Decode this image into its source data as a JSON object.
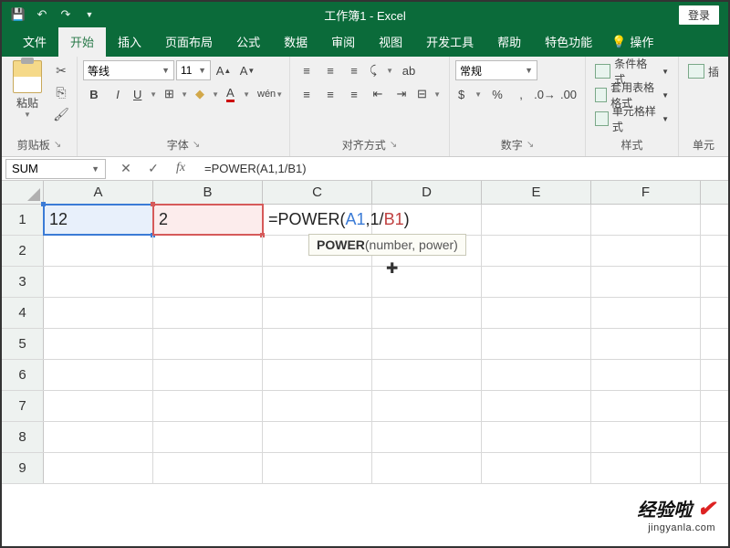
{
  "titlebar": {
    "title": "工作簿1 - Excel",
    "login": "登录"
  },
  "tabs": {
    "file": "文件",
    "home": "开始",
    "insert": "插入",
    "layout": "页面布局",
    "formulas": "公式",
    "data": "数据",
    "review": "审阅",
    "view": "视图",
    "developer": "开发工具",
    "help": "帮助",
    "special": "特色功能",
    "tell_me": "操作"
  },
  "ribbon": {
    "clipboard": {
      "label": "剪贴板",
      "paste": "粘贴"
    },
    "font": {
      "label": "字体",
      "name": "等线",
      "size": "11"
    },
    "align": {
      "label": "对齐方式"
    },
    "number": {
      "label": "数字",
      "format": "常规"
    },
    "styles": {
      "label": "样式",
      "conditional": "条件格式",
      "table": "套用表格格式",
      "cell": "单元格样式"
    },
    "cells": {
      "label": "单元",
      "insert": "插"
    }
  },
  "formula_bar": {
    "name_box": "SUM",
    "formula": "=POWER(A1,1/B1)"
  },
  "columns": [
    "A",
    "B",
    "C",
    "D",
    "E",
    "F"
  ],
  "rows": [
    "1",
    "2",
    "3",
    "4",
    "5",
    "6",
    "7",
    "8",
    "9"
  ],
  "cells": {
    "A1": "12",
    "B1": "2",
    "C1_prefix": "=POWER(",
    "C1_ref1": "A1",
    "C1_mid": ",1/",
    "C1_ref2": "B1",
    "C1_suffix": ")"
  },
  "tooltip": {
    "fn": "POWER",
    "args": "(number, power)"
  },
  "watermark": {
    "text": "经验啦",
    "check": "✔",
    "sub": "jingyanla.com"
  }
}
